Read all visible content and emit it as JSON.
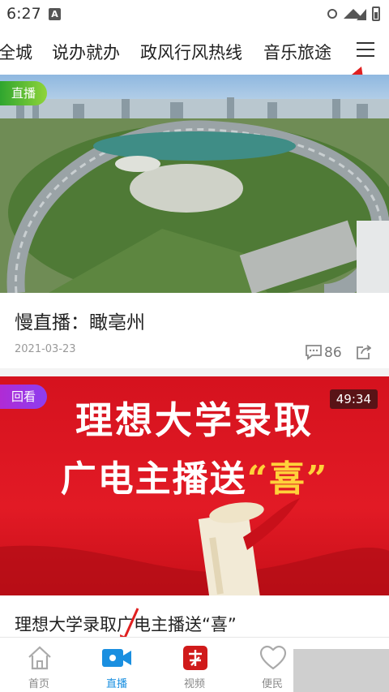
{
  "status": {
    "time": "6:27",
    "notification_letter": "A"
  },
  "topnav": {
    "items": [
      "全城",
      "说办就办",
      "政风行风热线",
      "音乐旅途"
    ]
  },
  "feed": {
    "card1": {
      "badge": "直播",
      "title": "慢直播：瞰亳州",
      "date": "2021-03-23",
      "comments": "86"
    },
    "card2": {
      "badge": "回看",
      "duration": "49:34",
      "poster_line1": "理想大学录取",
      "poster_line2_pre": "广电主播送",
      "poster_line2_quote": "“喜”",
      "title": "理想大学录取广电主播送“喜”"
    }
  },
  "tabbar": {
    "items": [
      {
        "label": "首页",
        "icon": "home-icon"
      },
      {
        "label": "直播",
        "icon": "live-video-icon",
        "active": true
      },
      {
        "label": "视频",
        "icon": "video-logo-icon"
      },
      {
        "label": "便民",
        "icon": "heart-icon"
      }
    ]
  },
  "colors": {
    "accent": "#1a8fe0",
    "live_badge": "#4cb82e",
    "replay_badge": "#9b35e0",
    "poster_red": "#d5121e",
    "annotation_arrow": "#e02020"
  }
}
